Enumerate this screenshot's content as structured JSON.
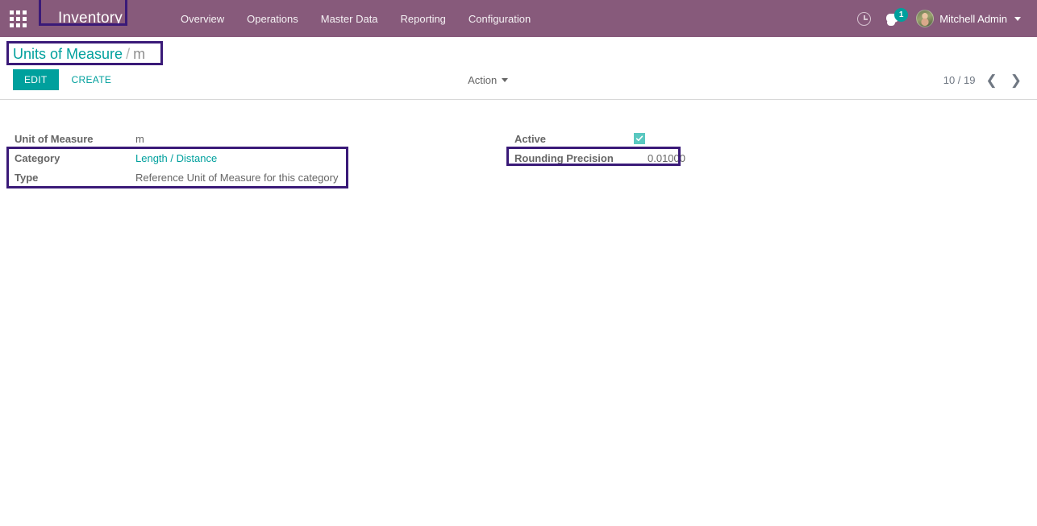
{
  "navbar": {
    "apps_icon": "apps-grid-icon",
    "brand": "Inventory",
    "menu": [
      {
        "label": "Overview"
      },
      {
        "label": "Operations"
      },
      {
        "label": "Master Data"
      },
      {
        "label": "Reporting"
      },
      {
        "label": "Configuration"
      }
    ],
    "activity_icon": "clock-icon",
    "messages_icon": "messages-icon",
    "messages_count": "1",
    "user_name": "Mitchell Admin",
    "user_caret_icon": "chevron-down-icon",
    "background_color": "#875a7b",
    "highlight_color": "#3a1a78"
  },
  "control_panel": {
    "breadcrumb": {
      "parent": "Units of Measure",
      "separator": "/",
      "current": "m"
    },
    "edit_label": "EDIT",
    "create_label": "CREATE",
    "action_label": "Action",
    "action_caret_icon": "caret-down-icon",
    "pager": {
      "count": "10 / 19",
      "prev_icon": "chevron-left-icon",
      "next_icon": "chevron-right-icon"
    },
    "accent_color": "#00a09d"
  },
  "form": {
    "left_fields": [
      {
        "label": "Unit of Measure",
        "value": "m",
        "type": "text"
      },
      {
        "label": "Category",
        "value": "Length / Distance",
        "type": "link"
      },
      {
        "label": "Type",
        "value": "Reference Unit of Measure for this category",
        "type": "text"
      }
    ],
    "right_fields": [
      {
        "label": "Active",
        "value": "",
        "type": "checkbox",
        "checked": true
      },
      {
        "label": "Rounding Precision",
        "value": "0.01000",
        "type": "number"
      }
    ],
    "checkbox_color": "#5ac8c0"
  }
}
